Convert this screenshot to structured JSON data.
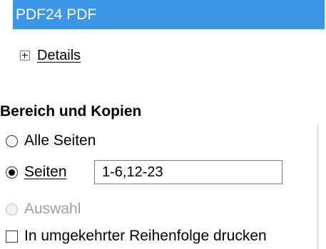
{
  "printer": {
    "selected": "PDF24 PDF"
  },
  "details": {
    "label": "Details"
  },
  "range": {
    "title": "Bereich und Kopien",
    "all_pages": "Alle Seiten",
    "pages": "Seiten",
    "pages_value": "1-6,12-23",
    "selection": "Auswahl",
    "reverse": "In umgekehrter Reihenfolge drucken"
  }
}
